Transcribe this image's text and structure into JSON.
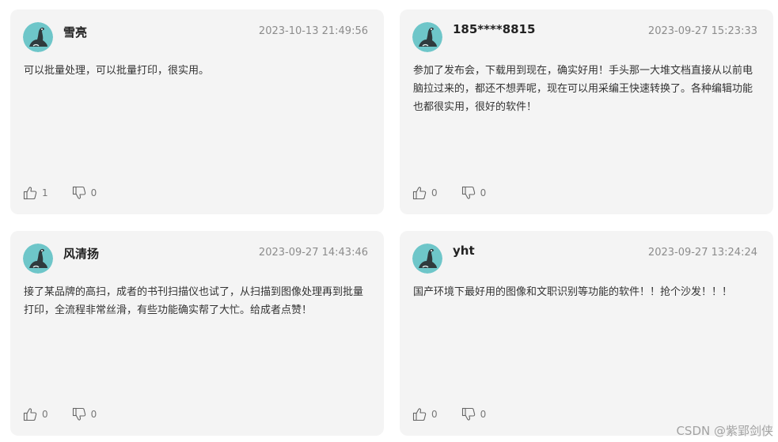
{
  "comments": [
    {
      "user": "雪亮",
      "time": "2023-10-13 21:49:56",
      "content": "可以批量处理，可以批量打印，很实用。",
      "likes": "1",
      "dislikes": "0",
      "avatar_icon": "seal-avatar-icon"
    },
    {
      "user": "185****8815",
      "time": "2023-09-27 15:23:33",
      "content": "参加了发布会，下载用到现在，确实好用！手头那一大堆文档直接从以前电脑拉过来的，都还不想弄呢，现在可以用采编王快速转换了。各种编辑功能也都很实用，很好的软件！",
      "likes": "0",
      "dislikes": "0",
      "avatar_icon": "seal-avatar-icon"
    },
    {
      "user": "风清扬",
      "time": "2023-09-27 14:43:46",
      "content": "接了某品牌的高扫，成者的书刊扫描仪也试了，从扫描到图像处理再到批量打印，全流程非常丝滑，有些功能确实帮了大忙。给成者点赞！",
      "likes": "0",
      "dislikes": "0",
      "avatar_icon": "seal-avatar-icon"
    },
    {
      "user": "yht",
      "time": "2023-09-27 13:24:24",
      "content": "国产环境下最好用的图像和文职识别等功能的软件！！抢个沙发！！！",
      "likes": "0",
      "dislikes": "0",
      "avatar_icon": "seal-avatar-icon"
    }
  ],
  "icons": {
    "like": "thumbs-up-icon",
    "dislike": "thumbs-down-icon"
  },
  "colors": {
    "card_bg": "#f4f4f4",
    "avatar_bg": "#6ec6c9",
    "text": "#333333",
    "muted": "#8c8c8c"
  },
  "watermark": "CSDN @紫郢剑侠"
}
